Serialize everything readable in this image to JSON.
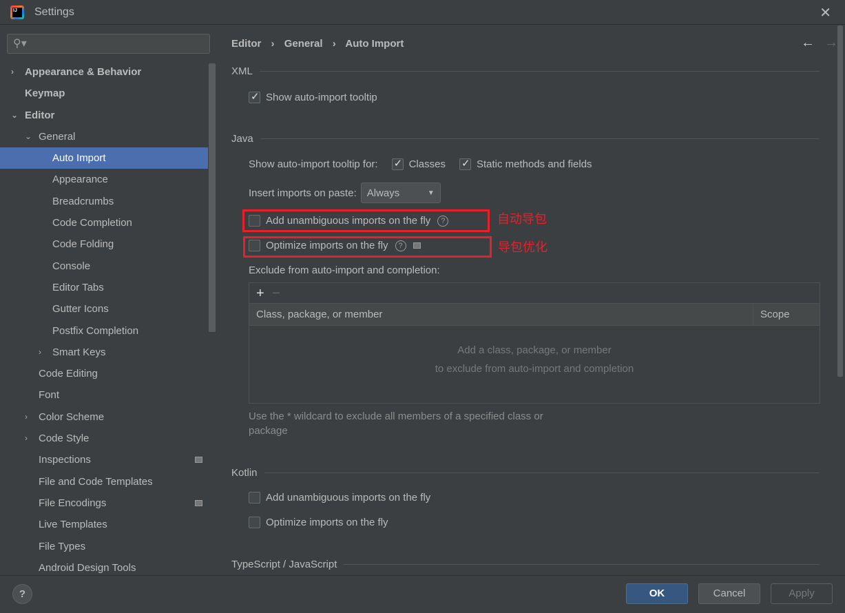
{
  "window": {
    "title": "Settings"
  },
  "search": {
    "placeholder": ""
  },
  "sidebar": {
    "items": [
      {
        "label": "Appearance & Behavior",
        "level": 0,
        "bold": true,
        "arrow": "›"
      },
      {
        "label": "Keymap",
        "level": 0,
        "bold": true,
        "arrow": ""
      },
      {
        "label": "Editor",
        "level": 0,
        "bold": true,
        "arrow": "⌄"
      },
      {
        "label": "General",
        "level": 1,
        "arrow": "⌄"
      },
      {
        "label": "Auto Import",
        "level": 2,
        "selected": true
      },
      {
        "label": "Appearance",
        "level": 2
      },
      {
        "label": "Breadcrumbs",
        "level": 2
      },
      {
        "label": "Code Completion",
        "level": 2
      },
      {
        "label": "Code Folding",
        "level": 2
      },
      {
        "label": "Console",
        "level": 2
      },
      {
        "label": "Editor Tabs",
        "level": 2
      },
      {
        "label": "Gutter Icons",
        "level": 2
      },
      {
        "label": "Postfix Completion",
        "level": 2
      },
      {
        "label": "Smart Keys",
        "level": 2,
        "arrow": "›"
      },
      {
        "label": "Code Editing",
        "level": 1
      },
      {
        "label": "Font",
        "level": 1
      },
      {
        "label": "Color Scheme",
        "level": 1,
        "arrow": "›"
      },
      {
        "label": "Code Style",
        "level": 1,
        "arrow": "›"
      },
      {
        "label": "Inspections",
        "level": 1,
        "ext": true
      },
      {
        "label": "File and Code Templates",
        "level": 1
      },
      {
        "label": "File Encodings",
        "level": 1,
        "ext": true
      },
      {
        "label": "Live Templates",
        "level": 1
      },
      {
        "label": "File Types",
        "level": 1
      },
      {
        "label": "Android Design Tools",
        "level": 1
      }
    ]
  },
  "breadcrumb": [
    "Editor",
    "General",
    "Auto Import"
  ],
  "breadcrumb_sep": "›",
  "xml": {
    "title": "XML",
    "show_tooltip": "Show auto-import tooltip"
  },
  "java": {
    "title": "Java",
    "tooltip_for": "Show auto-import tooltip for:",
    "classes": "Classes",
    "static": "Static methods and fields",
    "insert_label": "Insert imports on paste:",
    "insert_value": "Always",
    "add_unambiguous": "Add unambiguous imports on the fly",
    "optimize": "Optimize imports on the fly",
    "exclude_label": "Exclude from auto-import and completion:",
    "col_class": "Class, package, or member",
    "col_scope": "Scope",
    "empty1": "Add a class, package, or member",
    "empty2": "to exclude from auto-import and completion",
    "hint": "Use the * wildcard to exclude all members of a specified class or package"
  },
  "annotations": {
    "a1": "自动导包",
    "a2": "导包优化"
  },
  "kotlin": {
    "title": "Kotlin",
    "add_unambiguous": "Add unambiguous imports on the fly",
    "optimize": "Optimize imports on the fly"
  },
  "ts": {
    "title": "TypeScript / JavaScript"
  },
  "footer": {
    "help": "?",
    "ok": "OK",
    "cancel": "Cancel",
    "apply": "Apply"
  },
  "colors": {
    "selection": "#4b6eaf",
    "annotation": "#e8202a",
    "ok": "#365880"
  }
}
